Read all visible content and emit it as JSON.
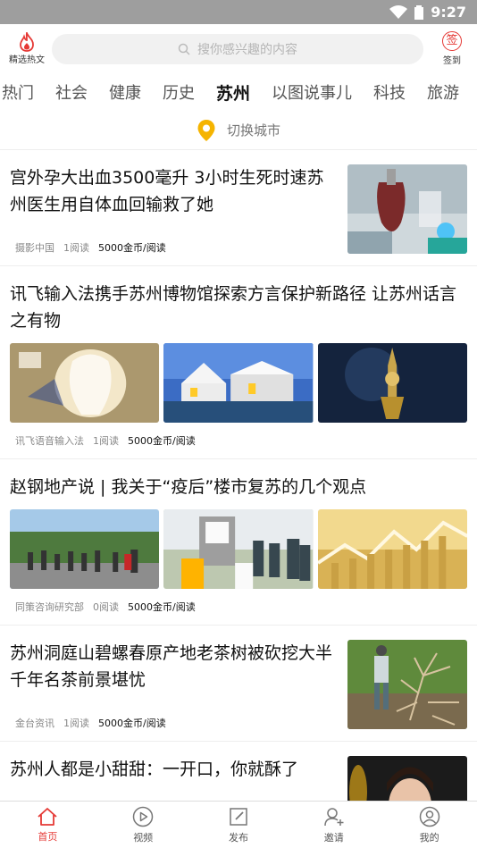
{
  "status": {
    "time": "9:27"
  },
  "header": {
    "hot_label": "精选热文",
    "search_placeholder": "搜你感兴趣的内容",
    "sign_glyph": "签",
    "sign_label": "签到"
  },
  "tabs": [
    {
      "label": "热门"
    },
    {
      "label": "社会"
    },
    {
      "label": "健康"
    },
    {
      "label": "历史"
    },
    {
      "label": "苏州",
      "active": true
    },
    {
      "label": "以图说事儿"
    },
    {
      "label": "科技"
    },
    {
      "label": "旅游"
    }
  ],
  "city": {
    "label": "切换城市"
  },
  "articles": [
    {
      "title": "宫外孕大出血3500毫升 3小时生死时速苏州医生用自体血回输救了她",
      "source": "摄影中国",
      "reads": "1阅读",
      "coins": "5000金币/阅读"
    },
    {
      "title": "讯飞输入法携手苏州博物馆探索方言保护新路径 让苏州话言之有物",
      "source": "讯飞语音输入法",
      "reads": "1阅读",
      "coins": "5000金币/阅读"
    },
    {
      "title": "赵钢地产说 | 我关于“疫后”楼市复苏的几个观点",
      "source": "同策咨询研究部",
      "reads": "0阅读",
      "coins": "5000金币/阅读"
    },
    {
      "title": "苏州洞庭山碧螺春原产地老茶树被砍挖大半 千年名茶前景堪忧",
      "source": "金台资讯",
      "reads": "1阅读",
      "coins": "5000金币/阅读"
    },
    {
      "title": "苏州人都是小甜甜：一开口，你就酥了",
      "source": "",
      "reads": "",
      "coins": ""
    }
  ],
  "nav": [
    {
      "label": "首页",
      "icon": "home-icon",
      "active": true
    },
    {
      "label": "视频",
      "icon": "video-icon"
    },
    {
      "label": "发布",
      "icon": "publish-icon"
    },
    {
      "label": "邀请",
      "icon": "invite-icon"
    },
    {
      "label": "我的",
      "icon": "profile-icon"
    }
  ],
  "colors": {
    "accent": "#e53935",
    "status_bar": "#9e9e9e",
    "location_pin": "#f5b400"
  }
}
